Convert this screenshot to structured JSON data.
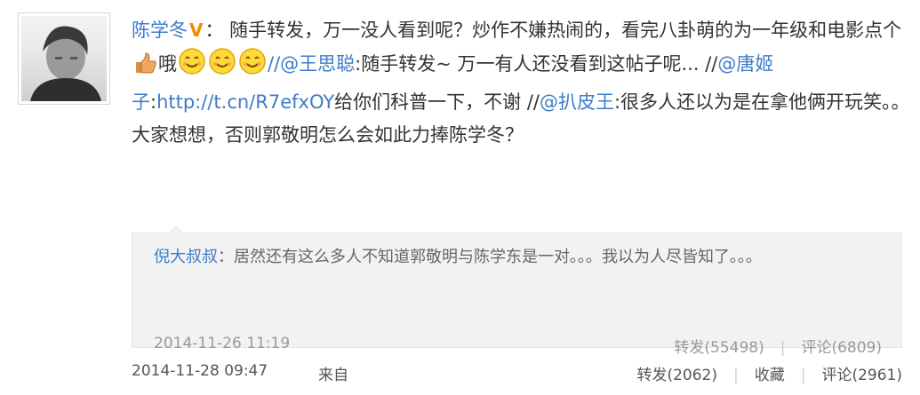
{
  "post": {
    "author": "陈学冬",
    "verified_badge": "V",
    "text_seg1": "：  随手转发，万一没人看到呢？炒作不嫌热闹的，看完八卦萌的为一年级和电影点个",
    "text_seg2": "哦",
    "text_seg3": "//",
    "mention1": "@王思聪",
    "text_seg4": ":随手转发~ 万一有人还没看到这帖子呢... //",
    "mention2": "@唐姬子",
    "text_seg5": ":",
    "link": "http://t.cn/R7efxOY",
    "text_seg6": "给你们科普一下，不谢 //",
    "mention3": "@扒皮王",
    "text_seg7": ":很多人还以为是在拿他俩开玩笑。。大家想想，否则郭敬明怎么会如此力捧陈学冬？",
    "emoji_names": [
      "thumbs-up-icon",
      "smile-face-icon",
      "smile-face-icon",
      "smile-face-icon"
    ]
  },
  "repost": {
    "author": "倪大叔叔",
    "text": "：居然还有这么多人不知道郭敬明与陈学东是一对。。。我以为人尽皆知了。。。",
    "time": "2014-11-26 11:19",
    "forward": "转发(55498)",
    "comment": "评论(6809)"
  },
  "footer": {
    "time": "2014-11-28 09:47",
    "via": "来自",
    "forward": "转发(2062)",
    "favorite": "收藏",
    "comment": "评论(2961)",
    "separator": "|"
  },
  "colors": {
    "link": "#3d7cc9",
    "badge": "#f28a00",
    "repost_bg": "#f2f2f2"
  }
}
